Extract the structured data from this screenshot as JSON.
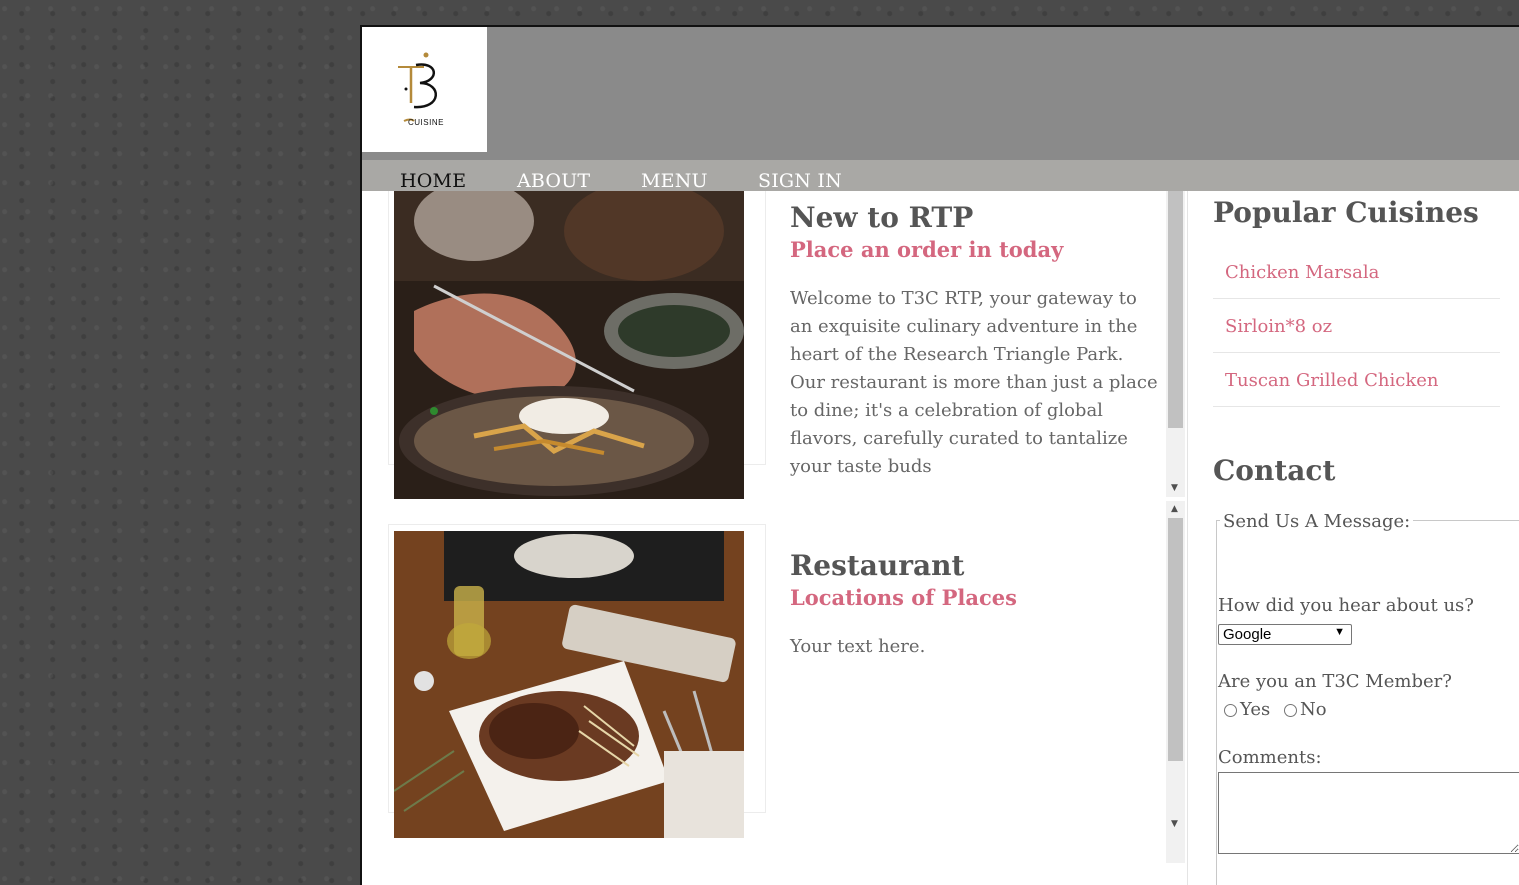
{
  "logo": {
    "letters": "T3",
    "wordmark": "CUISINE"
  },
  "nav": [
    {
      "label": "HOME",
      "active": true
    },
    {
      "label": "ABOUT",
      "active": false
    },
    {
      "label": "MENU",
      "active": false
    },
    {
      "label": "SIGN IN",
      "active": false
    }
  ],
  "cards": [
    {
      "title": "New to RTP",
      "subtitle": "Place an order in today",
      "body": "Welcome to T3C RTP, your gateway to an exquisite culinary adventure in the heart of the Research Triangle Park. Our restaurant is more than just a place to dine; it's a celebration of global flavors, carefully curated to tantalize your taste buds"
    },
    {
      "title": "Restaurant",
      "subtitle": "Locations of Places",
      "body": "Your text here."
    }
  ],
  "sidebar": {
    "popular_title": "Popular Cuisines",
    "popular_items": [
      "Chicken Marsala",
      "Sirloin*8 oz",
      "Tuscan Grilled Chicken"
    ],
    "contact_title": "Contact",
    "form": {
      "legend": "Send Us A Message:",
      "hear_label": "How did you hear about us?",
      "hear_selected": "Google",
      "member_label": "Are you an T3C Member?",
      "yes_label": "Yes",
      "no_label": "No",
      "comments_label": "Comments:",
      "comments_value": ""
    }
  },
  "colors": {
    "accent": "#d4677f",
    "header": "#8a8a8a",
    "nav": "#a9a8a5"
  }
}
